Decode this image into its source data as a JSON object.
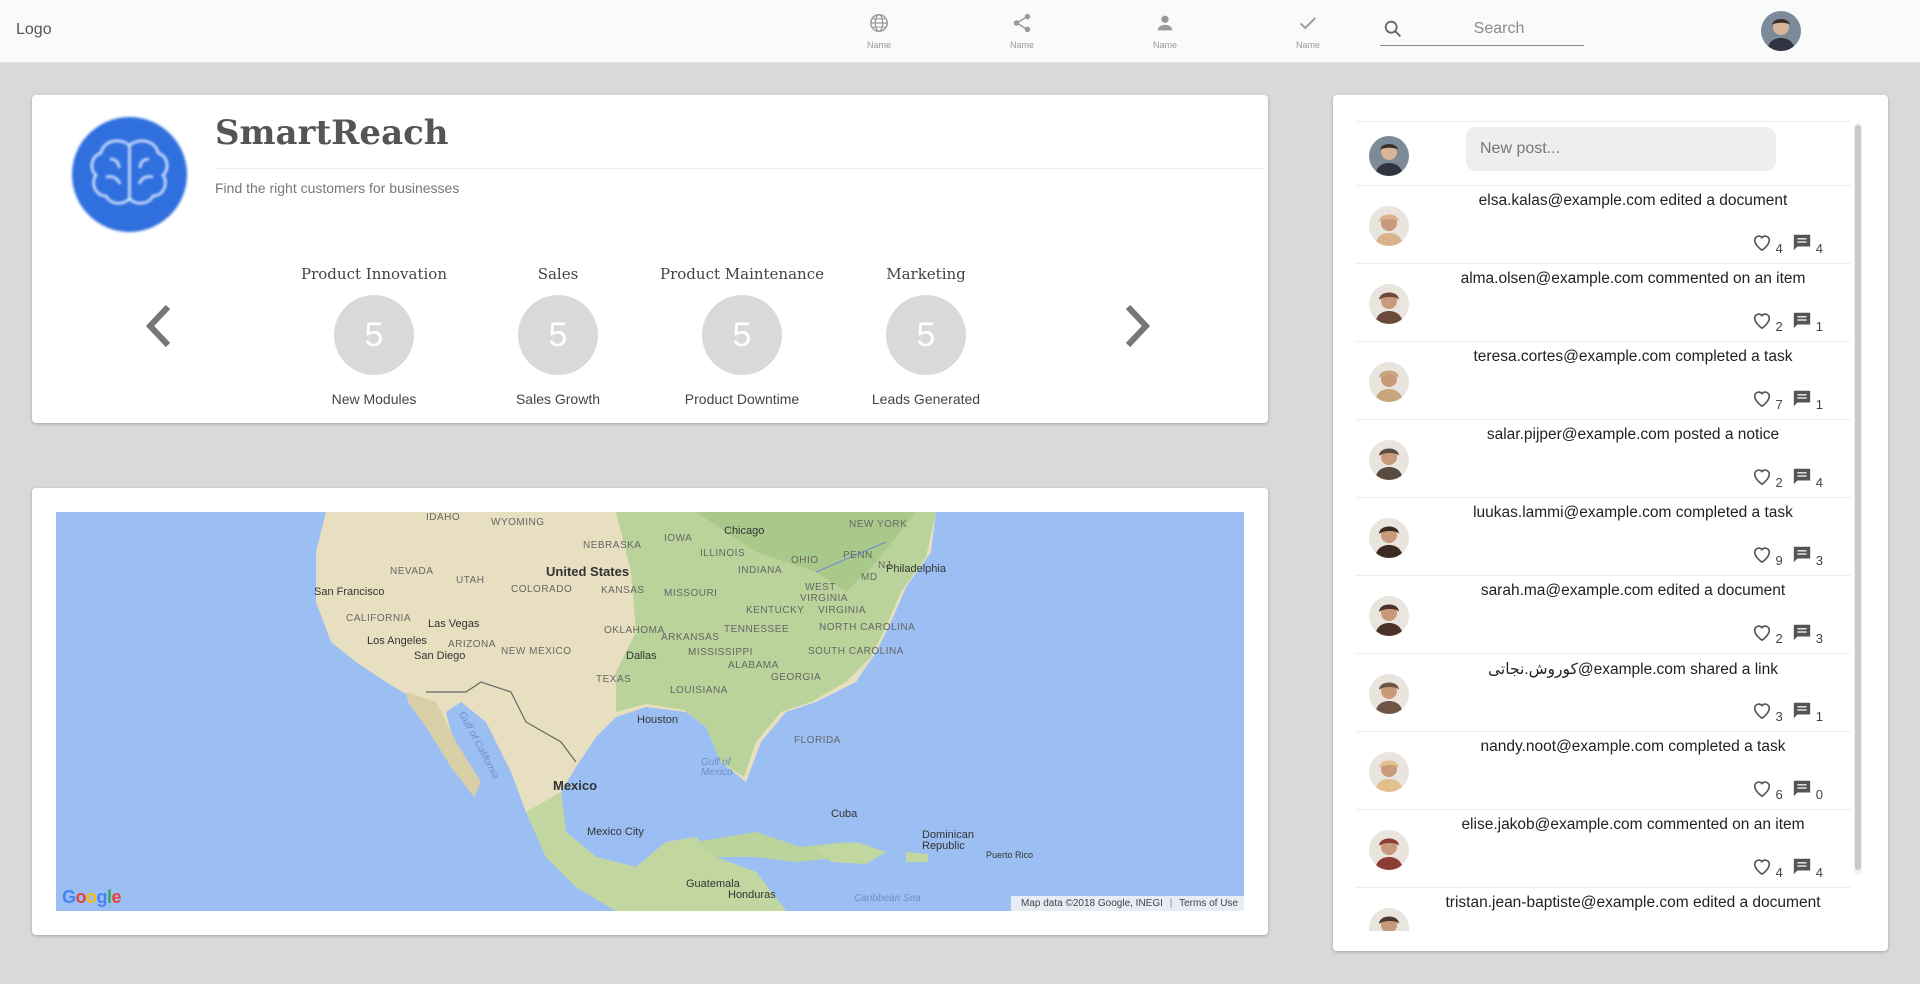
{
  "topbar": {
    "logo": "Logo",
    "nav": [
      {
        "label": "Name",
        "icon": "globe-icon"
      },
      {
        "label": "Name",
        "icon": "share-icon"
      },
      {
        "label": "Name",
        "icon": "person-icon"
      },
      {
        "label": "Name",
        "icon": "check-icon"
      }
    ],
    "search_placeholder": "Search"
  },
  "profile": {
    "title": "SmartReach",
    "subtitle": "Find the right customers for businesses",
    "kpis": [
      {
        "title": "Product Innovation",
        "value": "5",
        "label": "New Modules"
      },
      {
        "title": "Sales",
        "value": "5",
        "label": "Sales Growth"
      },
      {
        "title": "Product Maintenance",
        "value": "5",
        "label": "Product Downtime"
      },
      {
        "title": "Marketing",
        "value": "5",
        "label": "Leads Generated"
      }
    ]
  },
  "map": {
    "labels": {
      "idaho": "IDAHO",
      "wyoming": "WYOMING",
      "nebraska": "NEBRASKA",
      "iowa": "IOWA",
      "chicago": "Chicago",
      "new_york": "NEW YORK",
      "nevada": "NEVADA",
      "utah": "UTAH",
      "united_states": "United States",
      "illinois": "ILLINOIS",
      "indiana": "INDIANA",
      "ohio": "OHIO",
      "penn": "PENN",
      "philadelphia": "Philadelphia",
      "md": "MD",
      "nj": "NJ",
      "san_francisco": "San Francisco",
      "colorado": "COLORADO",
      "kansas": "KANSAS",
      "missouri": "MISSOURI",
      "west": "WEST",
      "virginia_w": "VIRGINIA",
      "virginia": "VIRGINIA",
      "kentucky": "KENTUCKY",
      "california": "CALIFORNIA",
      "las_vegas": "Las Vegas",
      "oklahoma": "OKLAHOMA",
      "tennessee": "TENNESSEE",
      "north_carolina": "NORTH CAROLINA",
      "los_angeles": "Los Angeles",
      "arizona": "ARIZONA",
      "arkansas": "ARKANSAS",
      "san_diego": "San Diego",
      "new_mexico": "NEW MEXICO",
      "dallas": "Dallas",
      "mississippi": "MISSISSIPPI",
      "south_carolina": "SOUTH CAROLINA",
      "alabama": "ALABAMA",
      "georgia": "GEORGIA",
      "texas": "TEXAS",
      "louisiana": "LOUISIANA",
      "houston": "Houston",
      "florida": "FLORIDA",
      "gulf_of_california": "Gulf of California",
      "gulf_of_mexico": "Gulf of Mexico",
      "mexico": "Mexico",
      "cuba": "Cuba",
      "mexico_city": "Mexico City",
      "dominican_republic": "Dominican Republic",
      "puerto_rico": "Puerto Rico",
      "guatemala": "Guatemala",
      "honduras": "Honduras",
      "caribbean_sea": "Caribbean Sea"
    },
    "google": "Google",
    "attribution": "Map data ©2018 Google, INEGI",
    "terms": "Terms of Use"
  },
  "feed": {
    "new_post_placeholder": "New post...",
    "items": [
      {
        "text": "elsa.kalas@example.com edited a document",
        "likes": "4",
        "comments": "4",
        "avatar_color": "#d9b48a"
      },
      {
        "text": "alma.olsen@example.com commented on an item",
        "likes": "2",
        "comments": "1",
        "avatar_color": "#6b4a3b"
      },
      {
        "text": "teresa.cortes@example.com completed a task",
        "likes": "7",
        "comments": "1",
        "avatar_color": "#c8a57c"
      },
      {
        "text": "salar.pijper@example.com posted a notice",
        "likes": "2",
        "comments": "4",
        "avatar_color": "#5a4b40"
      },
      {
        "text": "luukas.lammi@example.com completed a task",
        "likes": "9",
        "comments": "3",
        "avatar_color": "#3a2a22"
      },
      {
        "text": "sarah.ma@example.com edited a document",
        "likes": "2",
        "comments": "3",
        "avatar_color": "#4a3228"
      },
      {
        "text": "کوروش.نجاتی@example.com shared a link",
        "likes": "3",
        "comments": "1",
        "avatar_color": "#6e5546"
      },
      {
        "text": "nandy.noot@example.com completed a task",
        "likes": "6",
        "comments": "0",
        "avatar_color": "#e2c08e"
      },
      {
        "text": "elise.jakob@example.com commented on an item",
        "likes": "4",
        "comments": "4",
        "avatar_color": "#8c3b35"
      },
      {
        "text": "tristan.jean-baptiste@example.com edited a document",
        "likes": "",
        "comments": "",
        "avatar_color": "#4a3a2e"
      }
    ]
  }
}
